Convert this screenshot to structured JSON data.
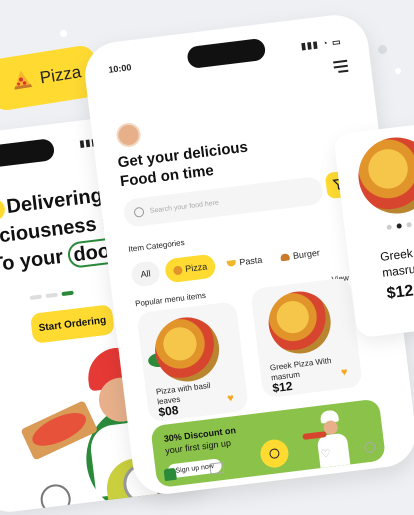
{
  "colors": {
    "accent": "#ffdb32",
    "green": "#8bc34a",
    "dark_green": "#2a8a3a",
    "background": "#eef0f3"
  },
  "pizza_tag": {
    "label": "Pizza",
    "icon": "pizza-slice-icon"
  },
  "left_phone": {
    "hero_lines": [
      "Delivering",
      "liciousness right",
      "To your ",
      "door!"
    ],
    "cta": "Start Ordering"
  },
  "main_phone": {
    "status_time": "10:00",
    "headline_1": "Get your delicious",
    "headline_2": "Food on time",
    "search_placeholder": "Search your food here",
    "categories_label": "Item Categories",
    "categories": [
      {
        "label": "All",
        "icon": ""
      },
      {
        "label": "Pizza",
        "icon": "pizza-icon"
      },
      {
        "label": "Pasta",
        "icon": "pasta-icon"
      },
      {
        "label": "Burger",
        "icon": "burger-icon"
      }
    ],
    "popular_label": "Popular menu items",
    "view_all": "View All",
    "items": [
      {
        "title": "Pizza with basil leaves",
        "price": "$08"
      },
      {
        "title": "Greek Pizza With masrum",
        "price": "$12"
      }
    ],
    "promo": {
      "line1": "30% Discount on",
      "line2": "your first sign up",
      "button": "Sign up now"
    },
    "nav": [
      "home-icon",
      "ticket-icon",
      "search-icon",
      "heart-icon",
      "profile-icon"
    ]
  },
  "right_phone": {
    "title_line1": "Greek P",
    "title_line2": "masrum",
    "price": "$12"
  }
}
